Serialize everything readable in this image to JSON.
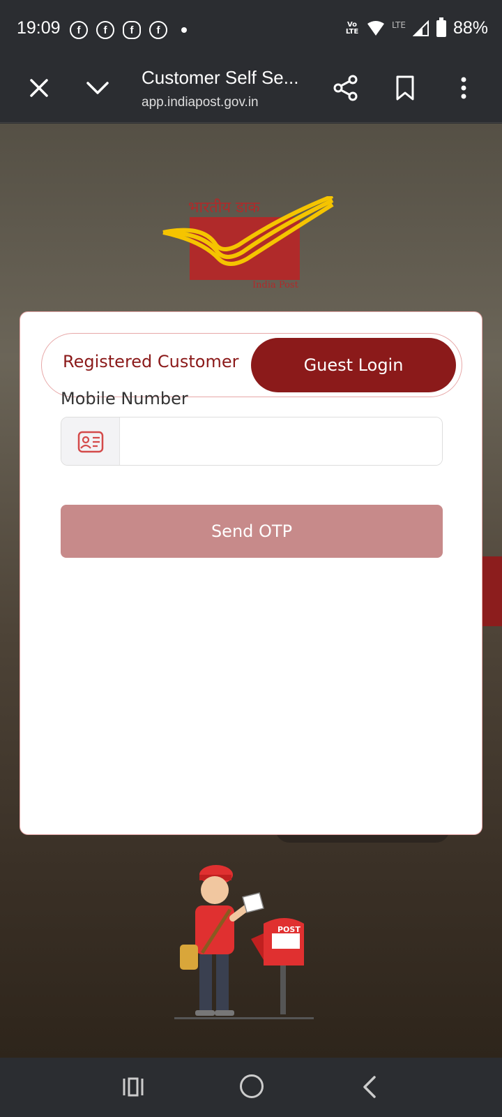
{
  "status_bar": {
    "time": "19:09",
    "battery": "88%",
    "volte": "Vo LTE",
    "lte": "LTE",
    "notification_icons": [
      "facebook-icon",
      "facebook-icon",
      "messenger-icon",
      "facebook-icon"
    ]
  },
  "browser": {
    "title": "Customer Self Se...",
    "url": "app.indiapost.gov.in"
  },
  "logo": {
    "hindi_text": "भारतीय डाक",
    "english_text": "India Post"
  },
  "login": {
    "tab_registered": "Registered Customer",
    "tab_guest": "Guest Login",
    "active_tab": "Guest Login",
    "mobile_label": "Mobile Number",
    "mobile_value": "",
    "send_otp_label": "Send OTP"
  },
  "illustration": {
    "mailbox_text": "POST"
  },
  "colors": {
    "brand_red": "#8b1a1a",
    "logo_red": "#b02a2a",
    "logo_yellow": "#f5c400",
    "button_disabled": "#c78a8a"
  }
}
